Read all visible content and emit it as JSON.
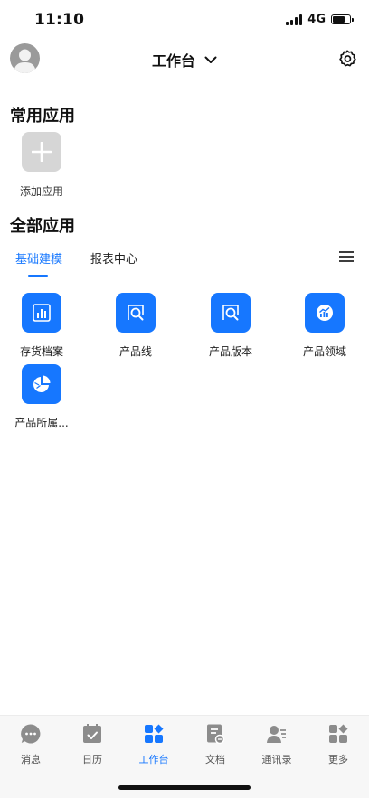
{
  "status_bar": {
    "time": "11:10",
    "network": "4G",
    "battery_level": 0.7
  },
  "header": {
    "title": "工作台"
  },
  "common_apps": {
    "title": "常用应用",
    "add_label": "添加应用"
  },
  "all_apps": {
    "title": "全部应用",
    "tabs": [
      {
        "label": "基础建模",
        "active": true
      },
      {
        "label": "报表中心",
        "active": false
      }
    ],
    "apps": [
      {
        "label": "存货档案",
        "icon": "bar-chart-icon"
      },
      {
        "label": "产品线",
        "icon": "search-doc-icon"
      },
      {
        "label": "产品版本",
        "icon": "search-doc-icon"
      },
      {
        "label": "产品领域",
        "icon": "trend-circle-icon"
      },
      {
        "label": "产品所属...",
        "icon": "pie-chart-icon"
      }
    ]
  },
  "bottom_nav": [
    {
      "label": "消息",
      "icon": "message-icon",
      "active": false
    },
    {
      "label": "日历",
      "icon": "calendar-icon",
      "active": false
    },
    {
      "label": "工作台",
      "icon": "workbench-icon",
      "active": true
    },
    {
      "label": "文档",
      "icon": "document-icon",
      "active": false
    },
    {
      "label": "通讯录",
      "icon": "contacts-icon",
      "active": false
    },
    {
      "label": "更多",
      "icon": "more-icon",
      "active": false
    }
  ],
  "colors": {
    "accent": "#1677ff",
    "tile_grey": "#d6d6d6",
    "icon_grey": "#8c8c8c"
  }
}
